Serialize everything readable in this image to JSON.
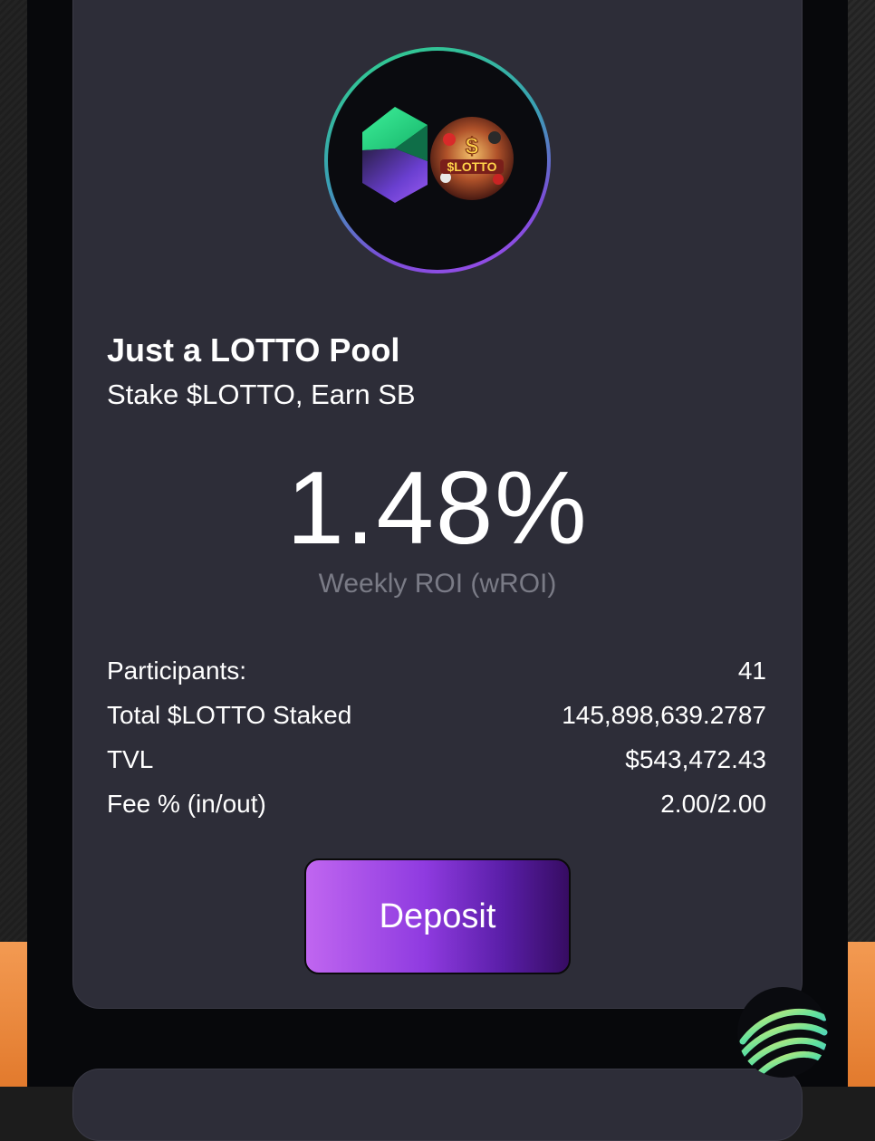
{
  "pool": {
    "title": "Just a LOTTO Pool",
    "subtitle": "Stake $LOTTO, Earn SB"
  },
  "roi": {
    "value": "1.48%",
    "label": "Weekly ROI (wROI)"
  },
  "stats": [
    {
      "label": "Participants:",
      "value": "41"
    },
    {
      "label": "Total $LOTTO Staked",
      "value": "145,898,639.2787"
    },
    {
      "label": "TVL",
      "value": "$543,472.43"
    },
    {
      "label": "Fee % (in/out)",
      "value": "2.00/2.00"
    }
  ],
  "actions": {
    "deposit_label": "Deposit"
  },
  "icons": {
    "pool_logo": "sb-lotto-pair-icon",
    "floating_badge": "swirl-badge-icon"
  },
  "colors": {
    "card_bg": "#2d2d38",
    "deposit_gradient_start": "#c066f0",
    "deposit_gradient_end": "#360c62",
    "ring_green": "#2fd38a",
    "ring_purple": "#a24cf0"
  }
}
